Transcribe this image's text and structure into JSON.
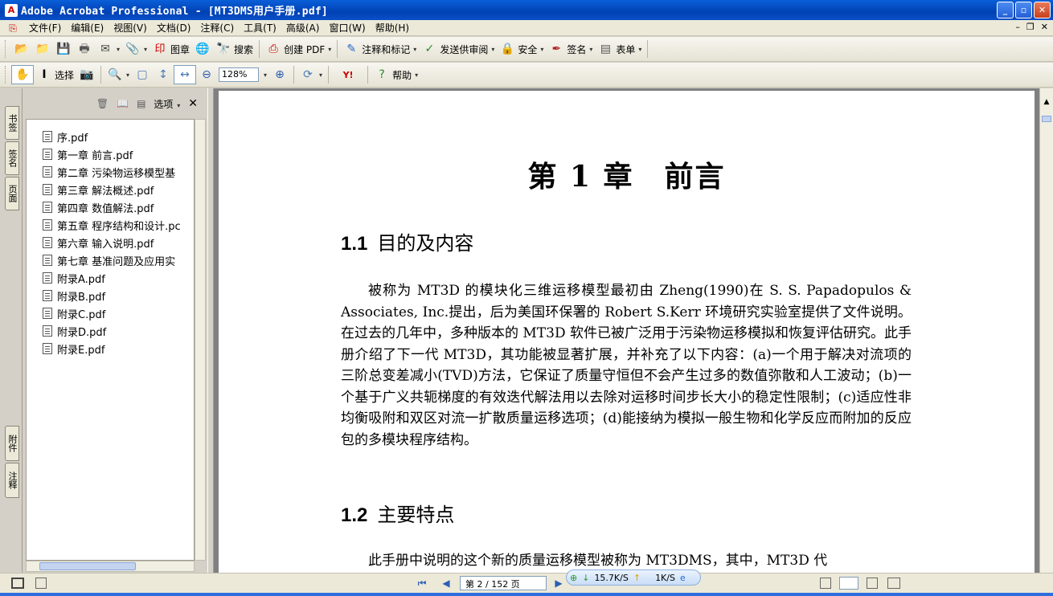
{
  "window": {
    "title": "Adobe Acrobat Professional - [MT3DMS用户手册.pdf]"
  },
  "menu": [
    "文件(F)",
    "编辑(E)",
    "视图(V)",
    "文档(D)",
    "注释(C)",
    "工具(T)",
    "高级(A)",
    "窗口(W)",
    "帮助(H)"
  ],
  "toolbar1": {
    "stamp": "图章",
    "search": "搜索",
    "create_pdf": "创建 PDF",
    "comment": "注释和标记",
    "send_review": "发送供审阅",
    "security": "安全",
    "sign": "签名",
    "forms": "表单"
  },
  "toolbar2": {
    "select": "选择",
    "zoom": "128%",
    "help": "帮助"
  },
  "sidebar": {
    "tabs": [
      "书签",
      "签名",
      "页面",
      "附件",
      "注释"
    ],
    "options": "选项",
    "bookmarks": [
      "序.pdf",
      "第一章 前言.pdf",
      "第二章 污染物运移模型基",
      "第三章 解法概述.pdf",
      "第四章 数值解法.pdf",
      "第五章 程序结构和设计.pc",
      "第六章 输入说明.pdf",
      "第七章 基准问题及应用实",
      "附录A.pdf",
      "附录B.pdf",
      "附录C.pdf",
      "附录D.pdf",
      "附录E.pdf"
    ]
  },
  "document": {
    "chapter_title": "第 1 章　前言",
    "s1_num": "1.1",
    "s1_title": "目的及内容",
    "s1_body": "被称为 MT3D 的模块化三维运移模型最初由 Zheng(1990)在 S. S. Papadopulos & Associates, Inc.提出，后为美国环保署的 Robert S.Kerr 环境研究实验室提供了文件说明。在过去的几年中，多种版本的 MT3D 软件已被广泛用于污染物运移模拟和恢复评估研究。此手册介绍了下一代 MT3D，其功能被显著扩展，并补充了以下内容：(a)一个用于解决对流项的三阶总变差减小(TVD)方法，它保证了质量守恒但不会产生过多的数值弥散和人工波动；(b)一个基于广义共轭梯度的有效迭代解法用以去除对运移时间步长大小的稳定性限制；(c)适应性非均衡吸附和双区对流一扩散质量运移选项；(d)能接纳为模拟一般生物和化学反应而附加的反应包的多模块程序结构。",
    "s2_num": "1.2",
    "s2_title": "主要特点",
    "s2_body": "此手册中说明的这个新的质量运移模型被称为 MT3DMS，其中，MT3D 代"
  },
  "status": {
    "page": "第 2 / 152 页",
    "down_speed": "15.7K/S",
    "up_speed": "1K/S"
  }
}
